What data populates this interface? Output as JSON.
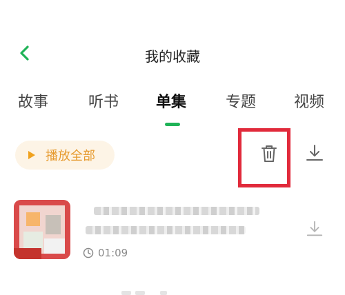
{
  "header": {
    "title": "我的收藏",
    "back_icon": "chevron-left-icon",
    "back_color": "#1fb357"
  },
  "tabs": [
    {
      "label": "故事",
      "active": false
    },
    {
      "label": "听书",
      "active": false
    },
    {
      "label": "单集",
      "active": true
    },
    {
      "label": "专题",
      "active": false
    },
    {
      "label": "视频",
      "active": false
    }
  ],
  "toolbar": {
    "play_all_label": "播放全部",
    "play_icon": "play-icon",
    "delete_icon": "trash-icon",
    "download_icon": "download-icon"
  },
  "colors": {
    "accent": "#1fb357",
    "play_all_bg": "#fdf4e6",
    "play_all_text": "#e69a2e",
    "highlight": "#e12a3b"
  },
  "list": {
    "items": [
      {
        "duration": "01:09",
        "clock_icon": "clock-icon",
        "download_icon": "download-icon"
      }
    ]
  }
}
